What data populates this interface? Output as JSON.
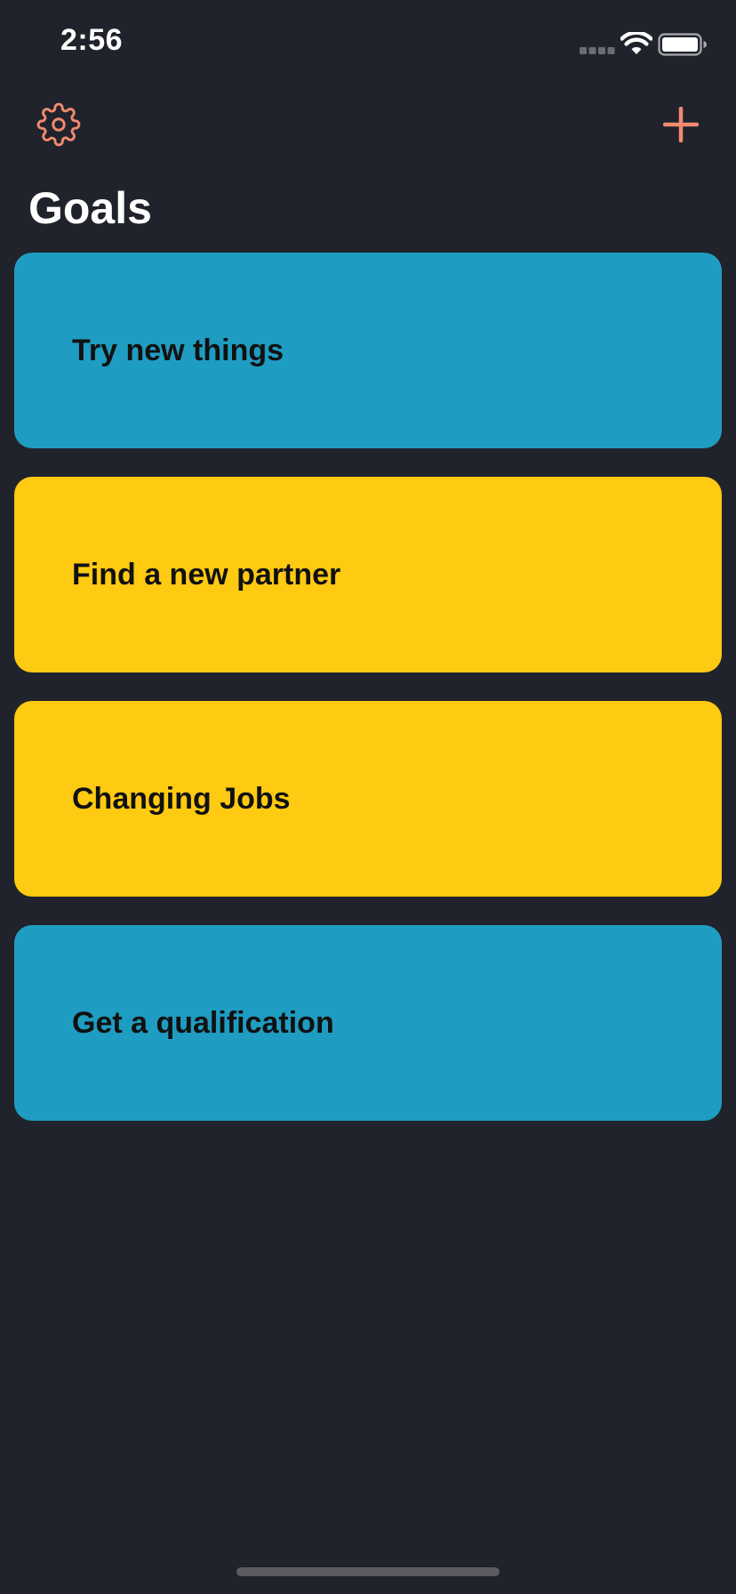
{
  "status_bar": {
    "time": "2:56"
  },
  "header": {
    "title": "Goals",
    "settings_icon": "gear-icon",
    "add_icon": "plus-icon",
    "accent_color": "#f08a6e"
  },
  "goals": [
    {
      "label": "Try new things",
      "color": "#1f9cc1"
    },
    {
      "label": "Find a new partner",
      "color": "#ffca12"
    },
    {
      "label": "Changing Jobs",
      "color": "#ffca12"
    },
    {
      "label": "Get a qualification",
      "color": "#1f9cc1"
    }
  ]
}
